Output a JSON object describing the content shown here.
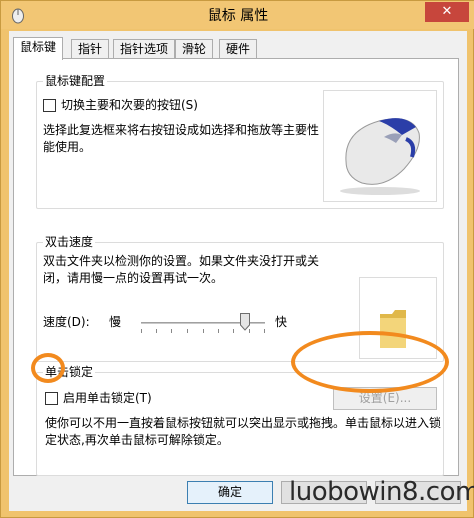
{
  "window": {
    "title": "鼠标 属性",
    "close_label": "✕"
  },
  "tabs": [
    {
      "label": "鼠标键",
      "active": true
    },
    {
      "label": "指针",
      "active": false
    },
    {
      "label": "指针选项",
      "active": false
    },
    {
      "label": "滑轮",
      "active": false
    },
    {
      "label": "硬件",
      "active": false
    }
  ],
  "button_config": {
    "title": "鼠标键配置",
    "checkbox_label": "切换主要和次要的按钮(S)",
    "checked": false,
    "description": "选择此复选框来将右按钮设成如选择和拖放等主要性能使用。"
  },
  "double_click": {
    "title": "双击速度",
    "description": "双击文件夹以检测你的设置。如果文件夹没打开或关闭，请用慢一点的设置再试一次。",
    "speed_label": "速度(D):",
    "slow_label": "慢",
    "fast_label": "快",
    "speed_level": 0.8
  },
  "click_lock": {
    "title": "单击锁定",
    "checkbox_label": "启用单击锁定(T)",
    "checked": false,
    "settings_button": "设置(E)...",
    "description": "使你可以不用一直按着鼠标按钮就可以突出显示或拖拽。单击鼠标以进入锁定状态,再次单击鼠标可解除锁定。"
  },
  "footer": {
    "ok_label": "确定"
  },
  "watermark": "luobowin8.com",
  "colors": {
    "highlight_orange": "#f28a1e",
    "window_frame": "#f0c36d",
    "close_red": "#c7463c"
  }
}
